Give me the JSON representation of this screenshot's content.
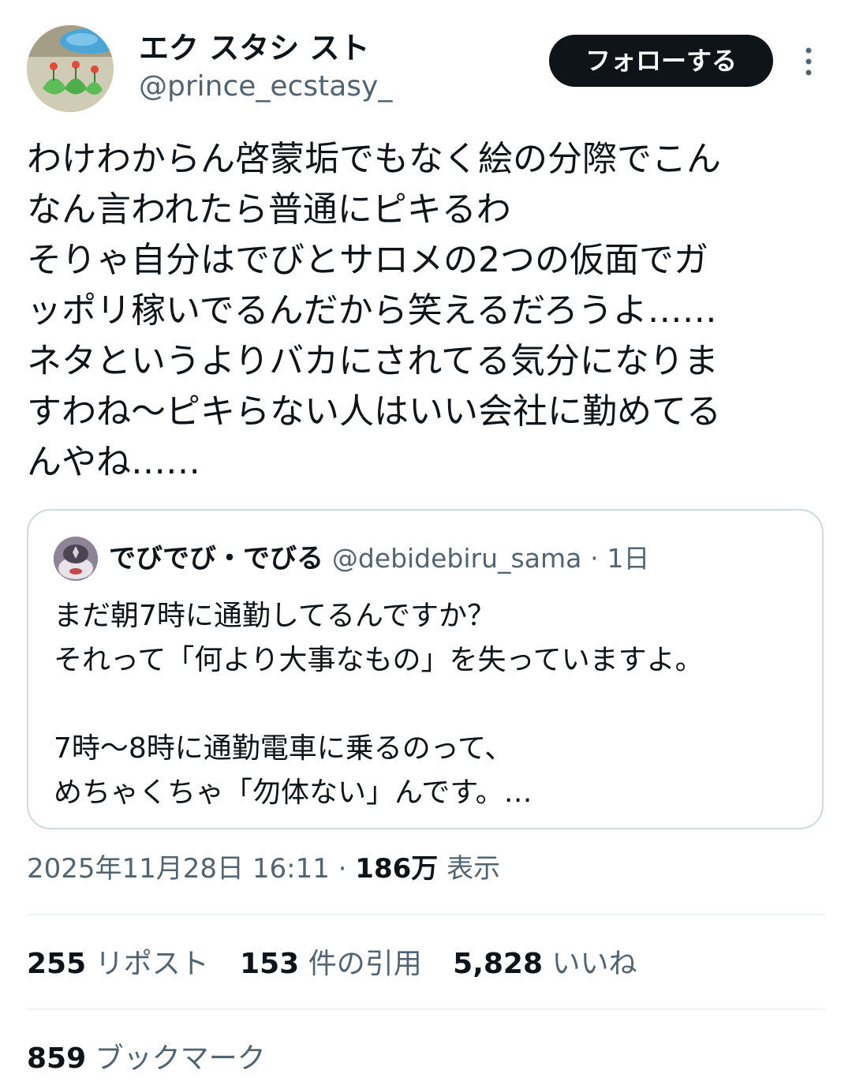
{
  "author": {
    "display_name": "エク スタシ スト",
    "handle": "@prince_ecstasy_",
    "avatar_icon": "avatar-image"
  },
  "follow_button": {
    "label": "フォローする"
  },
  "more_icon": "more-vertical-icon",
  "tweet": {
    "lines": [
      "わけわからん啓蒙垢でもなく絵の分際でこん",
      "なん言われたら普通にピキるわ",
      "そりゃ自分はでびとサロメの2つの仮面でガ",
      "ッポリ稼いでるんだから笑えるだろうよ……",
      "ネタというよりバカにされてる気分になりま",
      "すわね〜ピキらない人はいい会社に勤めてる",
      "んやね……"
    ]
  },
  "quote": {
    "display_name": "でびでび・でびる",
    "handle": "@debidebiru_sama",
    "separator": "·",
    "age": "1日",
    "lines": [
      "まだ朝7時に通勤してるんですか？",
      "それって「何より大事なもの」を失っていますよ。",
      "",
      "7時〜8時に通勤電車に乗るのって、",
      "めちゃくちゃ「勿体ない」んです。…"
    ]
  },
  "meta": {
    "timestamp": "2025年11月28日 16:11",
    "separator": "·",
    "views_count": "186万",
    "views_label": "表示"
  },
  "stats": {
    "reposts_count": "255",
    "reposts_label": "リポスト",
    "quotes_count": "153",
    "quotes_label": "件の引用",
    "likes_count": "5,828",
    "likes_label": "いいね",
    "bookmarks_count": "859",
    "bookmarks_label": "ブックマーク"
  },
  "colors": {
    "text_primary": "#0f1419",
    "text_secondary": "#536471",
    "border": "#cfd9de",
    "divider": "#eff3f4",
    "button_bg": "#0f1419",
    "button_text": "#ffffff"
  }
}
